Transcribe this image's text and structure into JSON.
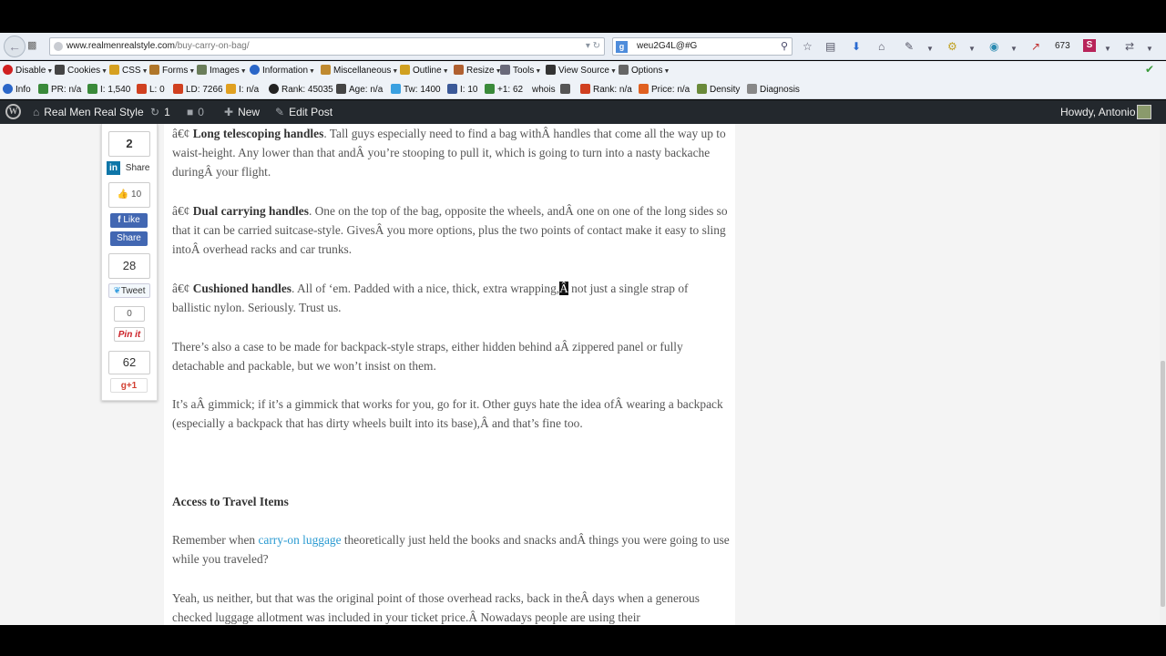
{
  "browser": {
    "url_host": "www.realmenrealstyle.com",
    "url_path": "/buy-carry-on-bag/",
    "search_value": "weu2G4L@#G",
    "counter": "673"
  },
  "toolbar1": [
    {
      "label": "Disable",
      "color": "#d02020"
    },
    {
      "label": "Cookies",
      "color": "#444444"
    },
    {
      "label": "CSS",
      "color": "#d6a020"
    },
    {
      "label": "Forms",
      "color": "#b0762a"
    },
    {
      "label": "Images",
      "color": "#6a7d5a"
    },
    {
      "label": "Information",
      "color": "#2a66c8"
    },
    {
      "label": "Miscellaneous",
      "color": "#c08a30"
    },
    {
      "label": "Outline",
      "color": "#d0a020"
    },
    {
      "label": "Resize",
      "color": "#b06030"
    },
    {
      "label": "Tools",
      "color": "#6a6a7a"
    },
    {
      "label": "View Source",
      "color": "#333333"
    },
    {
      "label": "Options",
      "color": "#666666"
    }
  ],
  "toolbar2": [
    {
      "label": "Info",
      "color": "#2a66c8"
    },
    {
      "label": "PR: n/a",
      "color": "#3a8a3a"
    },
    {
      "label": "I: 1,540",
      "color": "#3a8a3a"
    },
    {
      "label": "L: 0",
      "color": "#d04020"
    },
    {
      "label": "LD: 7266",
      "color": "#d04020"
    },
    {
      "label": "I: n/a",
      "color": "#e0a020"
    },
    {
      "label": "Rank: 45035",
      "color": "#222222"
    },
    {
      "label": "Age: n/a",
      "color": "#444444"
    },
    {
      "label": "Tw: 1400",
      "color": "#3aa0e0"
    },
    {
      "label": "I: 10",
      "color": "#3b5998"
    },
    {
      "label": "+1: 62",
      "color": "#3a8a3a"
    },
    {
      "label": "whois",
      "color": "#ffffff"
    },
    {
      "label": "",
      "color": "#555555"
    },
    {
      "label": "Rank: n/a",
      "color": "#d04020"
    },
    {
      "label": "Price: n/a",
      "color": "#e06020"
    },
    {
      "label": "Density",
      "color": "#6a8a3a"
    },
    {
      "label": "Diagnosis",
      "color": "#888888"
    }
  ],
  "wpbar": {
    "site": "Real Men Real Style",
    "updates": "1",
    "comments": "0",
    "new": "New",
    "edit": "Edit Post",
    "howdy": "Howdy, Antonio"
  },
  "share": {
    "count_top": "2",
    "linkedin": "Share",
    "likes": "10",
    "fb_like": "Like",
    "fb_share": "Share",
    "tweets_count": "28",
    "tweet": "Tweet",
    "pin_count": "0",
    "pinit": "Pin it",
    "gplus_count": "62",
    "gplus": "+1"
  },
  "article": {
    "p1_bullet": "â€¢",
    "p1_bold": "Long telescoping handles",
    "p1_text": ". Tall guys especially need to find a bag withÂ handles that come all the way up to waist-height. Any lower than that andÂ you’re stooping to pull it, which is going to turn into a nasty backache duringÂ your flight.",
    "p2_bullet": "â€¢",
    "p2_bold": "Dual carrying handles",
    "p2_text": ". One on the top of the bag, opposite the wheels, andÂ one on one of the long sides so that it can be carried suitcase-style. GivesÂ you more options, plus the two points of contact make it easy to sling intoÂ overhead racks and car trunks.",
    "p3_bullet": "â€¢",
    "p3_bold": "Cushioned handles",
    "p3_text_a": ". All of ‘em. Padded with a nice, thick, extra wrapping,",
    "p3_highlight": "Â",
    "p3_text_b": " not just a single strap of ballistic nylon. Seriously. Trust us.",
    "p4": "There’s also a case to be made for backpack-style straps, either hidden behind aÂ zippered panel or fully detachable and packable, but we won’t insist on them.",
    "p5": "It’s aÂ gimmick; if it’s a gimmick that works for you, go for it. Other guys hate the idea ofÂ wearing a backpack (especially a backpack that has dirty wheels built into its base),Â and that’s fine too.",
    "heading": "Access to Travel Items",
    "p6_a": "Remember when ",
    "p6_link": "carry-on luggage",
    "p6_b": " theoretically just held the books and snacks andÂ things you were going to use while you traveled?",
    "p7": "Yeah, us neither, but that was the original point of those overhead racks, back in theÂ days when a generous checked luggage allotment was included in your ticket price.Â Nowadays people are using their"
  }
}
